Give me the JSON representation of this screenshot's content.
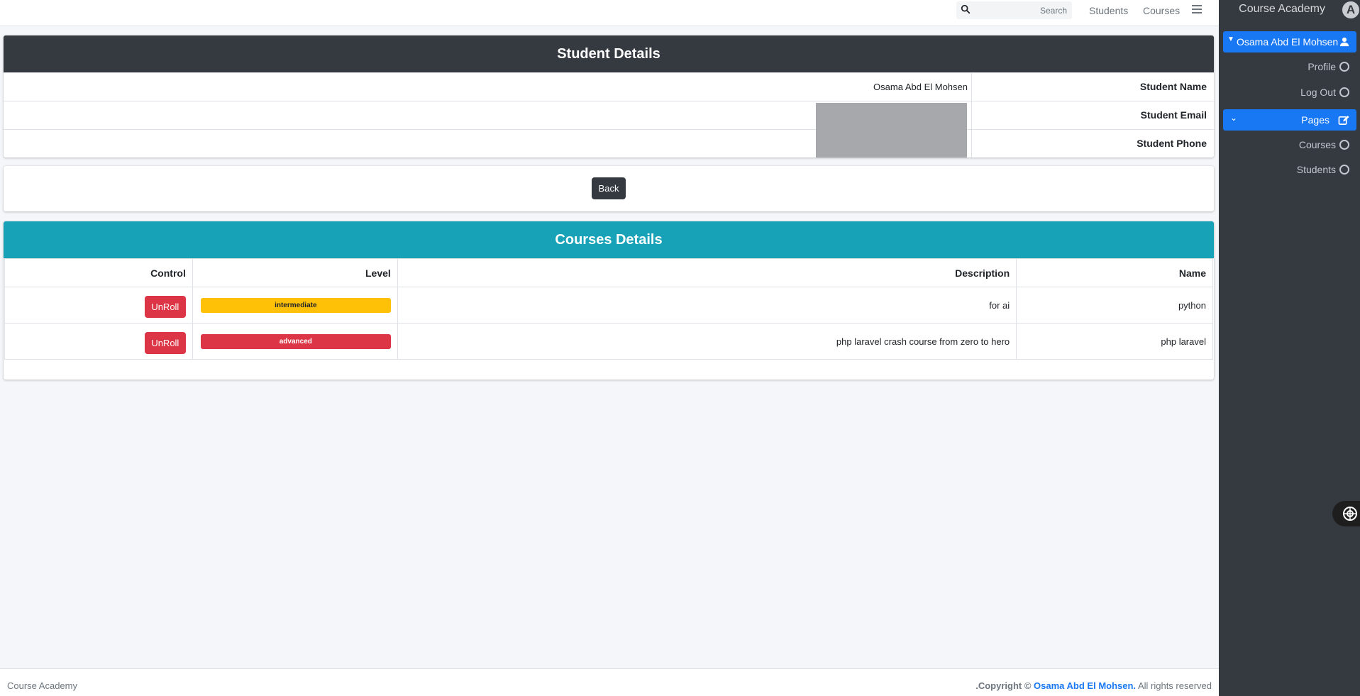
{
  "navbar": {
    "search_placeholder": "Search",
    "links": [
      "Students",
      "Courses"
    ]
  },
  "sidebar": {
    "brand": "Course Academy",
    "brand_logo_letter": "A",
    "user": "Osama Abd El Mohsen",
    "user_items": [
      "Profile",
      "Log Out"
    ],
    "pages_label": "Pages",
    "page_items": [
      "Courses",
      "Students"
    ]
  },
  "student": {
    "title": "Student Details",
    "fields": [
      {
        "label": "Student Name",
        "value": "Osama Abd El Mohsen"
      },
      {
        "label": "Student Email",
        "value": ""
      },
      {
        "label": "Student Phone",
        "value": ""
      }
    ]
  },
  "back_label": "Back",
  "courses": {
    "title": "Courses Details",
    "headers": [
      "Control",
      "Level",
      "Description",
      "Name"
    ],
    "rows": [
      {
        "control": "UnRoll",
        "level": "intermediate",
        "description": "for ai",
        "name": "python"
      },
      {
        "control": "UnRoll",
        "level": "advanced",
        "description": "php laravel crash course from zero to hero",
        "name": "php laravel"
      }
    ]
  },
  "footer": {
    "left": "Course Academy",
    "copyright": ".Copyright ©",
    "owner": "Osama Abd El Mohsen.",
    "rights": "All rights reserved"
  },
  "colors": {
    "sidebar_bg": "#343a40",
    "primary": "#1877f2",
    "info": "#17a2b8",
    "warning": "#ffc107",
    "danger": "#dc3545"
  }
}
